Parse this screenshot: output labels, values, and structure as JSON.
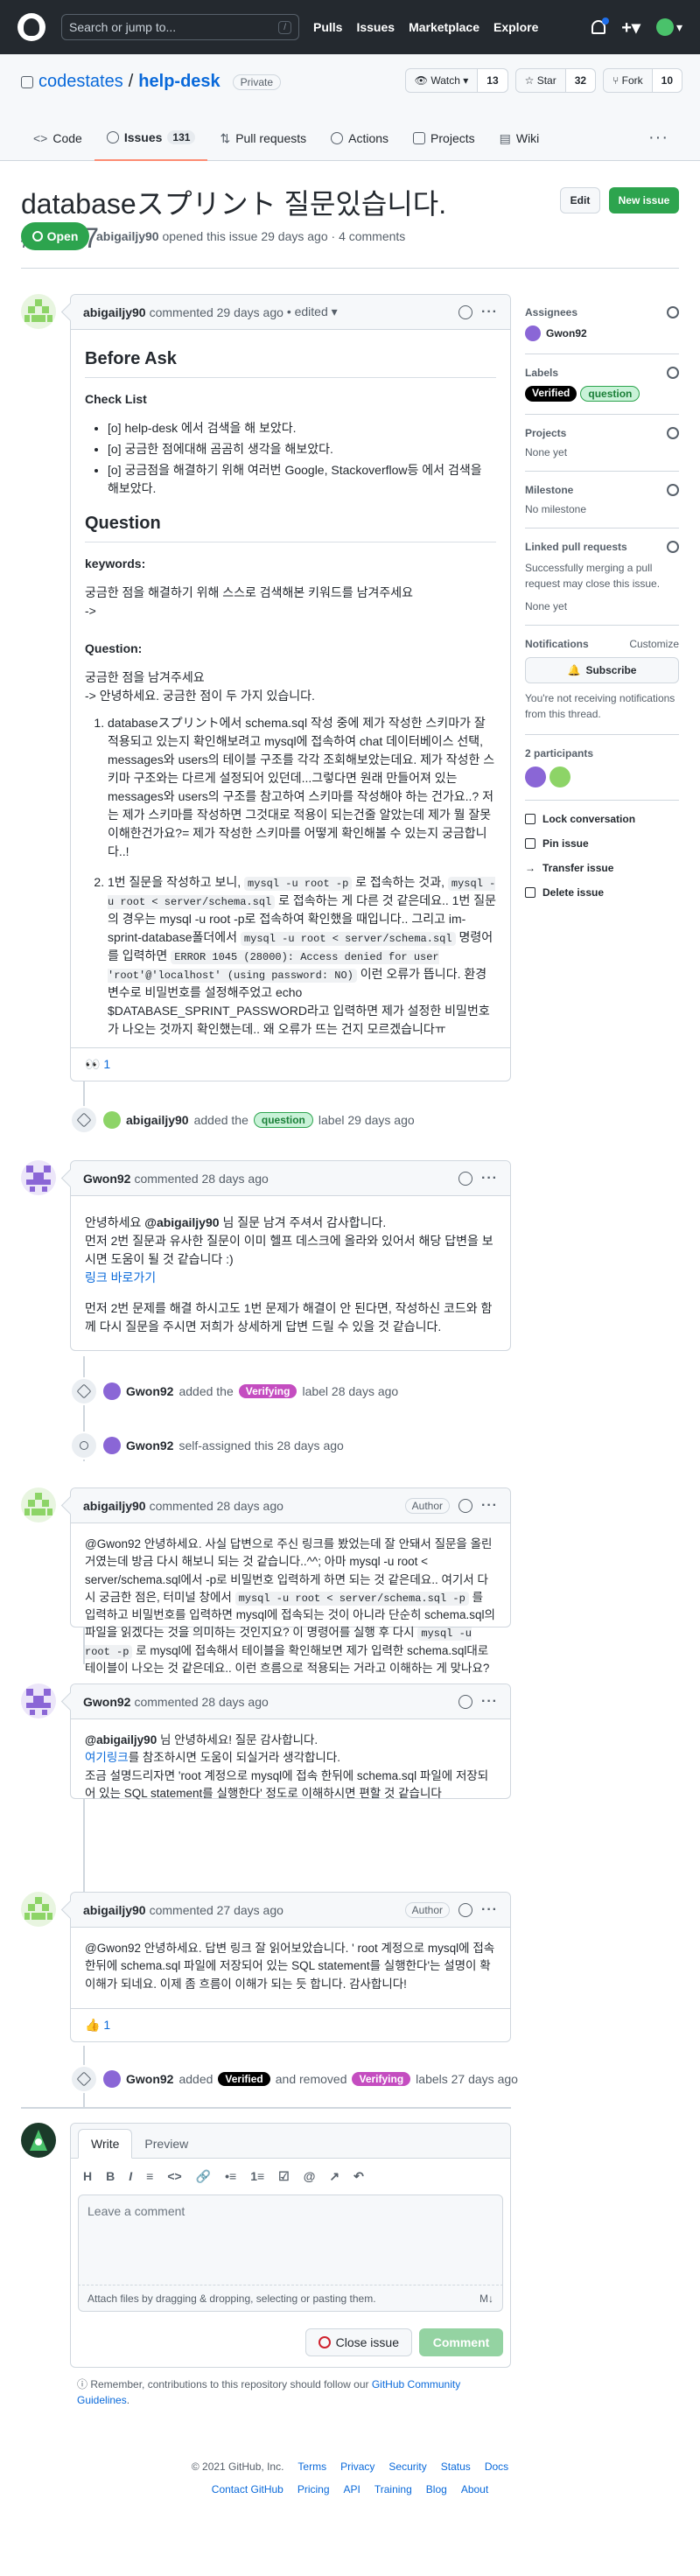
{
  "header": {
    "search_placeholder": "Search or jump to...",
    "slash": "/",
    "nav": [
      "Pulls",
      "Issues",
      "Marketplace",
      "Explore"
    ]
  },
  "repo": {
    "owner": "codestates",
    "sep": "/",
    "name": "help-desk",
    "visibility": "Private",
    "watch": {
      "label": "Watch",
      "count": "13"
    },
    "star": {
      "label": "Star",
      "count": "32"
    },
    "fork": {
      "label": "Fork",
      "count": "10"
    },
    "tabs": [
      {
        "label": "Code"
      },
      {
        "label": "Issues",
        "count": "131"
      },
      {
        "label": "Pull requests"
      },
      {
        "label": "Actions"
      },
      {
        "label": "Projects"
      },
      {
        "label": "Wiki"
      }
    ]
  },
  "issue": {
    "title": "databaseスプリント 질문있습니다.",
    "number": "#2767",
    "edit": "Edit",
    "new_issue": "New issue",
    "state": "Open",
    "meta_author": "abigailjy90",
    "meta_text": "opened this issue 29 days ago · 4 comments"
  },
  "comment1": {
    "author": "abigailjy90",
    "time": "commented 29 days ago",
    "edited": "• edited ▾",
    "h_before": "Before Ask",
    "h_checklist": "Check List",
    "checks": [
      "[o] help-desk 에서 검색을 해 보았다.",
      "[o] 궁금한 점에대해 곰곰히 생각을 해보았다.",
      "[o] 궁금점을 해결하기 위해 여러번 Google, Stackoverflow등 에서 검색을 해보았다."
    ],
    "h_question": "Question",
    "h_keywords": "keywords:",
    "kw1": "궁금한 점을 해결하기 위해 스스로 검색해본 키워드를 남겨주세요",
    "kw2": "->",
    "h_question2": "Question:",
    "q1": "궁금한 점을 남겨주세요",
    "q2": "-> 안녕하세요. 궁금한 점이 두 가지 있습니다.",
    "item1": "databaseスプリント에서 schema.sql 작성 중에 제가 작성한 스키마가 잘 적용되고 있는지 확인해보려고 mysql에 접속하여 chat 데이터베이스 선택, messages와 users의 테이블 구조를 각각 조회해보았는데요. 제가 작성한 스키마 구조와는 다르게 설정되어 있던데...그렇다면 원래 만들어져 있는 messages와 users의 구조를 참고하여 스키마를 작성해야 하는 건가요..? 저는 제가 스키마를 작성하면 그것대로 적용이 되는건줄 알았는데 제가 뭘 잘못이해한건가요?= 제가 작성한 스키마를 어떻게 확인해볼 수 있는지 궁금합니다..!",
    "item2a": "1번 질문을 작성하고 보니,",
    "item2code1": "mysql -u root -p",
    "item2b": "로 접속하는 것과,",
    "item2code2": "mysql -u root < server/schema.sql",
    "item2c": "로 접속하는 게 다른 것 같은데요.. 1번 질문의 경우는 mysql -u root -p로 접속하여 확인했을 때입니다.. 그리고 im-sprint-database폴더에서",
    "item2code3": "mysql -u root < server/schema.sql",
    "item2d": "명령어를 입력하면",
    "item2code4": "ERROR 1045 (28000): Access denied for user 'root'@'localhost' (using password: NO)",
    "item2e": "이런 오류가 뜹니다. 환경변수로 비밀번호를 설정해주었고 echo $DATABASE_SPRINT_PASSWORD라고 입력하면 제가 설정한 비밀번호가 나오는 것까지 확인했는데.. 왜 오류가 뜨는 건지 모르겠습니다ㅠ",
    "reaction": "👀 1"
  },
  "event1": {
    "user": "abigailjy90",
    "action": "added the",
    "label": "question",
    "tail": "label 29 days ago"
  },
  "comment2": {
    "author": "Gwon92",
    "time": "commented 28 days ago",
    "p1a": "안녕하세요",
    "p1m": "@abigailjy90",
    "p1b": "님 질문 남겨 주셔서 감사합니다.",
    "p2": "먼저 2번 질문과 유사한 질문이 이미 헬프 데스크에 올라와 있어서 해당 답변을 보시면 도움이 될 것 같습니다 :)",
    "link": "링크 바로가기",
    "p3": "먼저 2번 문제를 해결 하시고도 1번 문제가 해결이 안 된다면, 작성하신 코드와 함께 다시 질문을 주시면 저희가 상세하게 답변 드릴 수 있을 것 같습니다."
  },
  "event2": {
    "user": "Gwon92",
    "action": "added the",
    "label": "Verifying",
    "tail": "label 28 days ago"
  },
  "event3": {
    "user": "Gwon92",
    "action": "self-assigned this 28 days ago"
  },
  "comment3": {
    "author": "abigailjy90",
    "time": "commented 28 days ago",
    "badge": "Author",
    "a": "@Gwon92 안녕하세요. 사실 답변으로 주신 링크를 봤었는데 잘 안돼서 질문을 올린 거였는데 방금 다시 해보니 되는 것 같습니다..^^; 아마 mysql -u root < server/schema.sql에서 -p로 비밀번호 입력하게 하면 되는 것 같은데요.. 여기서 다시 궁금한 점은, 터미널 창에서",
    "code1": "mysql -u root < server/schema.sql -p",
    "b": "를 입력하고 비밀번호를 입력하면 mysql에 접속되는 것이 아니라 단순히 schema.sql의 파일을 읽겠다는 것을 의미하는 것인지요? 이 명령어를 실행 후 다시",
    "code2": "mysql -u root -p",
    "c": "로 mysql에 접속해서 테이블을 확인해보면 제가 입력한 schema.sql대로 테이블이 나오는 것 같은데요.. 이런 흐름으로 적용되는 거라고 이해하는 게 맞나요?"
  },
  "comment4": {
    "author": "Gwon92",
    "time": "commented 28 days ago",
    "m": "@abigailjy90",
    "a": "님 안녕하세요! 질문 감사합니다.",
    "link": "여기링크",
    "b": "를 참조하시면 도움이 되실거라 생각합니다.",
    "c": "조금 설명드리자면 'root 계정으로 mysql에 접속 한뒤에 schema.sql 파일에 저장되어 있는 SQL statement를 실행한다' 정도로 이해하시면 편할 것 같습니다"
  },
  "comment5": {
    "author": "abigailjy90",
    "time": "commented 27 days ago",
    "badge": "Author",
    "text": "@Gwon92 안녕하세요. 답변 링크 잘 읽어보았습니다. ' root 계정으로 mysql에 접속 한뒤에 schema.sql 파일에 저장되어 있는 SQL statement를 실행한다'는 설명이 확 이해가 되네요. 이제 좀 흐름이 이해가 되는 듯 합니다. 감사합니다!",
    "reaction": "👍 1"
  },
  "event4": {
    "user": "Gwon92",
    "action": "added",
    "label1": "Verified",
    "mid": "and removed",
    "label2": "Verifying",
    "tail": "labels 27 days ago"
  },
  "composer": {
    "tab_write": "Write",
    "tab_preview": "Preview",
    "tools": [
      "H",
      "B",
      "I",
      "≡",
      "<>",
      "🔗",
      "•≡",
      "1≡",
      "☑",
      "@",
      "↗",
      "↶"
    ],
    "placeholder": "Leave a comment",
    "attach": "Attach files by dragging & dropping, selecting or pasting them.",
    "md": "M↓",
    "close": "Close issue",
    "comment": "Comment"
  },
  "remember": {
    "text": "Remember, contributions to this repository should follow our",
    "link": "GitHub Community Guidelines",
    "end": "."
  },
  "sidebar": {
    "assignees": "Assignees",
    "assignee": "Gwon92",
    "labels": "Labels",
    "label1": "Verified",
    "label2": "question",
    "projects": "Projects",
    "projects_val": "None yet",
    "milestone": "Milestone",
    "milestone_val": "No milestone",
    "linked": "Linked pull requests",
    "linked_desc": "Successfully merging a pull request may close this issue.",
    "linked_val": "None yet",
    "notifications": "Notifications",
    "customize": "Customize",
    "subscribe": "Subscribe",
    "notif_desc": "You're not receiving notifications from this thread.",
    "participants": "2 participants",
    "actions": [
      "Lock conversation",
      "Pin issue",
      "Transfer issue",
      "Delete issue"
    ]
  },
  "footer": {
    "copy": "© 2021 GitHub, Inc.",
    "row1": [
      "Terms",
      "Privacy",
      "Security",
      "Status",
      "Docs"
    ],
    "row2": [
      "Contact GitHub",
      "Pricing",
      "API",
      "Training",
      "Blog",
      "About"
    ]
  },
  "colors": {
    "header": "#24292f",
    "green": "#2da44e",
    "verifying": "#c44dc0",
    "verified": "#000000",
    "link": "#0969da"
  }
}
